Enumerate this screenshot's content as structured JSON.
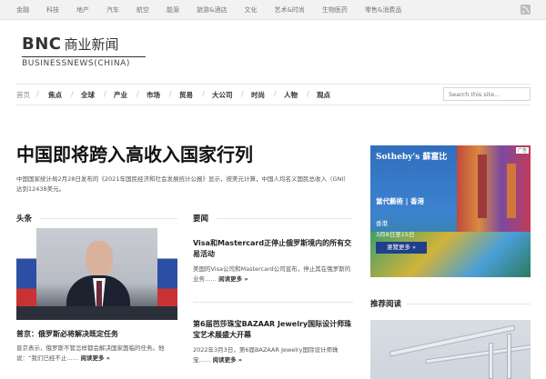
{
  "topbar": {
    "categories": [
      "金融",
      "科技",
      "地产",
      "汽车",
      "航空",
      "能源",
      "旅游&酒店",
      "文化",
      "艺术&时尚",
      "生物医药",
      "零售&消费品"
    ]
  },
  "logo": {
    "main": "BNC",
    "cn": "商业新闻",
    "sub": "BUSINESSNEWS(CHINA)"
  },
  "nav": {
    "home": "首页",
    "items": [
      "焦点",
      "全球",
      "产业",
      "市场",
      "贸易",
      "大公司",
      "时尚",
      "人物",
      "观点"
    ]
  },
  "search": {
    "placeholder": "Search this site..."
  },
  "headline": {
    "title": "中国即将跨入高收入国家行列",
    "lead": "中国国家统计局2月28日发布的《2021年国民经济和社会发展统计公报》显示，按美元计算，中国人均名义国民总收入（GNI）达到12438美元。"
  },
  "sections": {
    "top": "头条",
    "news": "要闻",
    "recommended": "推荐阅读"
  },
  "main_story": {
    "title": "普京：俄罗斯必将解决既定任务",
    "summary": "普京表示，俄罗斯不管怎样都会解决国家面临的任务。他说：“我们已经不止……",
    "more": "阅读更多 »"
  },
  "news": [
    {
      "title": "Visa和Mastercard正停止俄罗斯境内的所有交易活动",
      "summary": "美国的Visa公司和Mastercard公司宣布，停止其在俄罗斯的业务……",
      "more": "阅读更多 »"
    },
    {
      "title": "第6届芭莎珠宝BAZAAR Jewelry国际设计师珠宝艺术展盛大开幕",
      "summary": "2022年3月3日，第6届BAZAAR Jewelry国际设计师珠宝……",
      "more": "阅读更多 »"
    }
  ],
  "ad": {
    "brand": "Sotheby's 蘇富比",
    "tag": "广告",
    "name": "當代藝術 | 香港",
    "place": "香港",
    "dates": "3月8日至15日",
    "button": "瀏覽更多 »"
  },
  "colors": {
    "topbar_bg": "#f2f2f2",
    "text": "#222222",
    "ad_button": "#1f3f8a"
  }
}
